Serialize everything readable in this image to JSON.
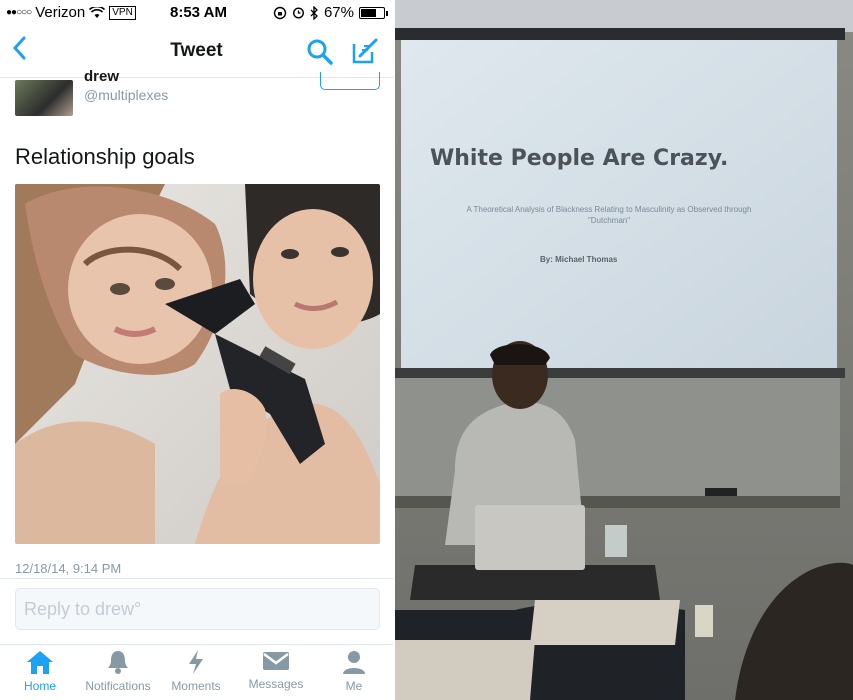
{
  "status_bar": {
    "carrier": "Verizon",
    "vpn": "VPN",
    "time": "8:53 AM",
    "battery": "67%",
    "battery_level": 0.67
  },
  "nav": {
    "back": "<",
    "title": "Tweet"
  },
  "tweet": {
    "name": "drew",
    "handle": "@multiplexes",
    "text": "Relationship goals",
    "timestamp": "12/18/14, 9:14 PM"
  },
  "reply": {
    "placeholder": "Reply to drew°"
  },
  "tabs": [
    {
      "label": "Home",
      "icon": "home-icon",
      "active": true
    },
    {
      "label": "Notifications",
      "icon": "bell-icon",
      "active": false
    },
    {
      "label": "Moments",
      "icon": "lightning-icon",
      "active": false
    },
    {
      "label": "Messages",
      "icon": "envelope-icon",
      "active": false
    },
    {
      "label": "Me",
      "icon": "person-icon",
      "active": false
    }
  ],
  "slide": {
    "title": "White People Are Crazy.",
    "subtitle": "A Theoretical Analysis of Blackness Relating to Masculinity as Observed through \"Dutchman\"",
    "author": "By: Michael Thomas"
  },
  "colors": {
    "accent": "#1da1f2",
    "muted": "#8899a6"
  }
}
